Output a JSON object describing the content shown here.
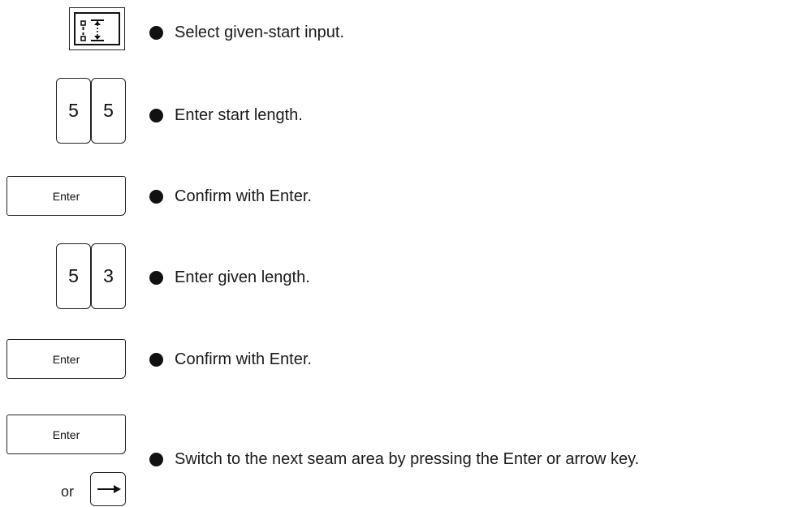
{
  "steps": [
    {
      "text": "Select given-start input."
    },
    {
      "keys": [
        "5",
        "5"
      ],
      "text": "Enter start length."
    },
    {
      "key": "Enter",
      "text_prefix": "Confirm with ",
      "text_key": "Enter",
      "text_suffix": "."
    },
    {
      "keys": [
        "5",
        "3"
      ],
      "text": "Enter given length."
    },
    {
      "key": "Enter",
      "text_prefix": "Confirm with ",
      "text_key": "Enter",
      "text_suffix": "."
    },
    {
      "key": "Enter",
      "or_label": "or",
      "text_prefix": "Switch to the next seam area by pressing the ",
      "text_key1": "Enter",
      "text_mid": " or ",
      "text_key2": "arrow",
      "text_suffix": " key."
    }
  ],
  "icons": {
    "step1_key": "given-start-input-icon",
    "step6_alt_key": "arrow-right-icon"
  }
}
